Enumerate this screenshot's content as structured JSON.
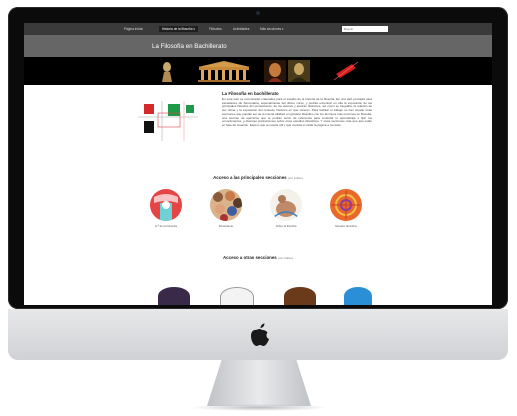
{
  "site": {
    "nav": {
      "items": [
        {
          "label": "Página inicial"
        },
        {
          "label": "Historia de la filosofía ▾"
        },
        {
          "label": "Filósofos"
        },
        {
          "label": "Actividades"
        },
        {
          "label": "Más secciones ▾"
        }
      ],
      "search_placeholder": "Buscar"
    },
    "title": "La Filosofía en Bachillerato",
    "banner_images": [
      "bust-icon",
      "temple-icon",
      "philosopher-portrait",
      "mona-lisa",
      "red-laser-figure"
    ],
    "intro": {
      "title": "La Filosofía en bachillerato",
      "text": "En esta web se encontrarán materiales para el estudio de la historia de la filosofía. Es una web pensada para estudiantes de Secundaria, especialmente del último curso, y podrás encontrar en ella la exposición de los principales filósofos del pensamiento, de los autores y autoras históricos, así como su biografía, la relación de sus obras y la exposición del contexto histórico en que vivieron. Para facilitar el trabajo se han creado otras secciones que puedan ser de la misma utilidad: un glosario filosófico con los términos más comunes en filosofía, una sección de ejercicios que te podrán servir de referencia para controlar tu aprendizaje o fijar tus conocimientos, y diversas producciones sobre otros estudios filosóficos. Y otras secciones más que aún están en fase de creación. Espero que te resulte útil y que vuelvas a visitar la página a menudo."
    },
    "main_sections": {
      "heading": "Acceso a las principales secciones",
      "sub": "(ver índice)",
      "items": [
        {
          "label": "H.ª de la Filosofía"
        },
        {
          "label": "Filosofando"
        },
        {
          "label": "Sobre la filosofía"
        },
        {
          "label": "Glosario filosófico"
        }
      ]
    },
    "other_sections": {
      "heading": "Acceso a otras secciones",
      "sub": "(ver índice)"
    }
  },
  "device": {
    "logo": "apple-logo-icon"
  }
}
